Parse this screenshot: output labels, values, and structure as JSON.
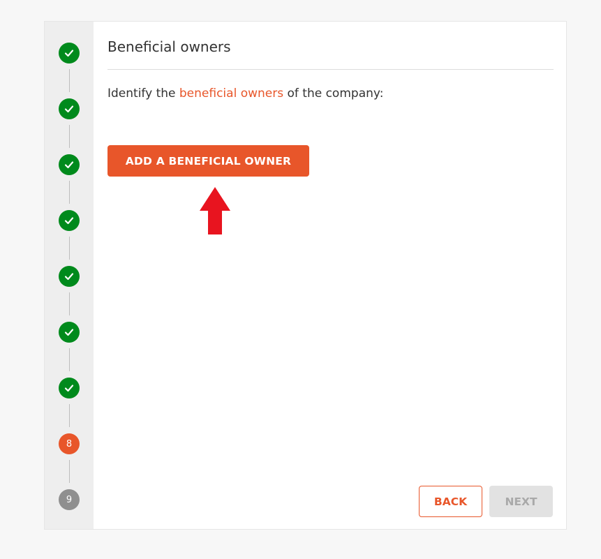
{
  "stepper": {
    "steps": [
      {
        "status": "done",
        "label": ""
      },
      {
        "status": "done",
        "label": ""
      },
      {
        "status": "done",
        "label": ""
      },
      {
        "status": "done",
        "label": ""
      },
      {
        "status": "done",
        "label": ""
      },
      {
        "status": "done",
        "label": ""
      },
      {
        "status": "done",
        "label": ""
      },
      {
        "status": "current",
        "label": "8"
      },
      {
        "status": "future",
        "label": "9"
      }
    ],
    "icon": "check-icon"
  },
  "header": {
    "title": "Beneficial owners"
  },
  "intro": {
    "before": "Identify the ",
    "link": "beneficial owners",
    "after": " of the company:"
  },
  "actions": {
    "add_label": "ADD A BENEFICIAL OWNER",
    "back_label": "BACK",
    "next_label": "NEXT"
  },
  "annotation": {
    "icon": "red-arrow-up-icon"
  },
  "colors": {
    "accent": "#e8562a",
    "done": "#008a1c",
    "future": "#8f8f8f",
    "arrow": "#e8141f"
  }
}
